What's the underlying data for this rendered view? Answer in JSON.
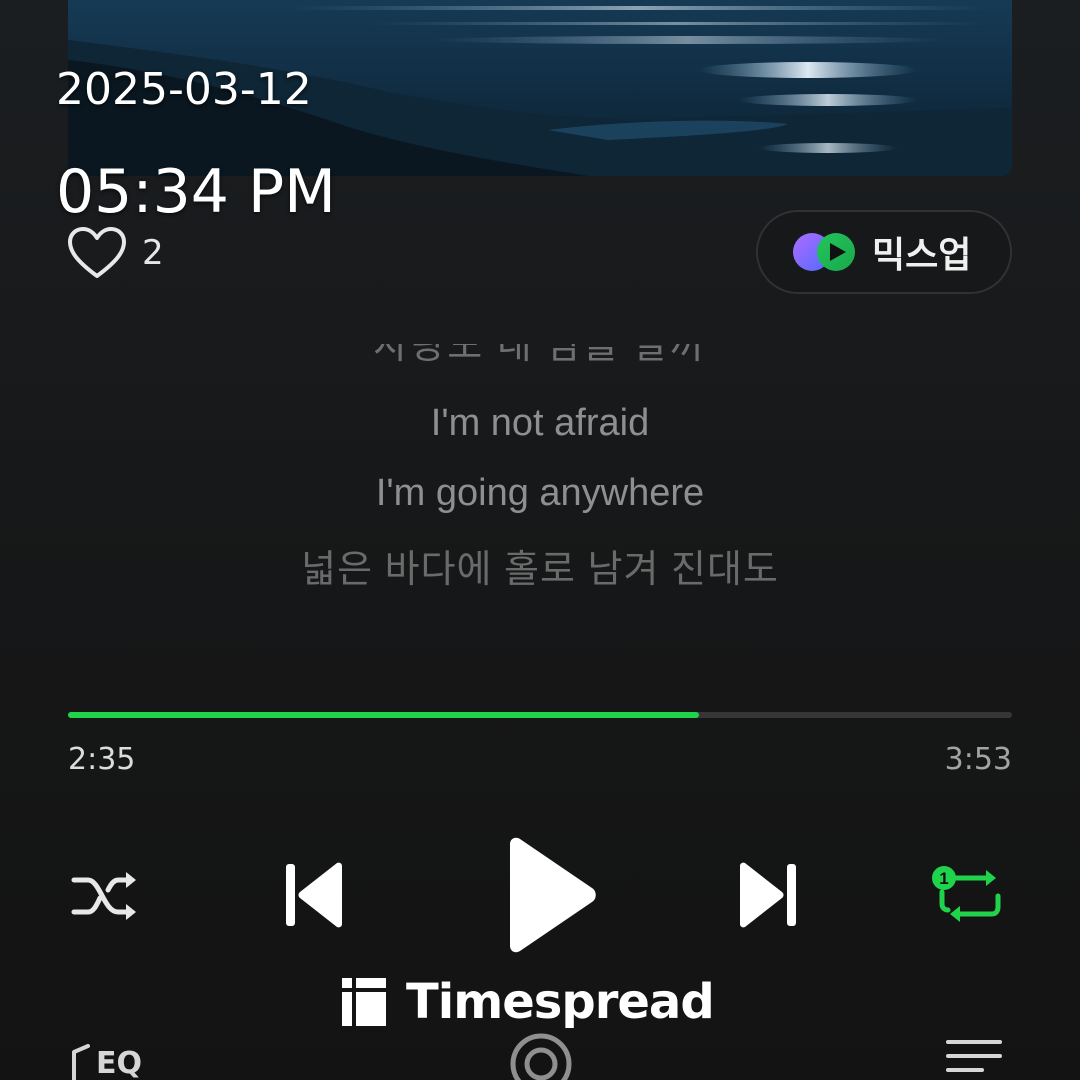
{
  "overlay": {
    "date": "2025-03-12",
    "time": "05:34 PM"
  },
  "track": {
    "like_count": "2",
    "mixup_label": "믹스업"
  },
  "lyrics": {
    "partial_line": "사랑도 내 맘을 알까",
    "lines": [
      "I'm not afraid",
      "I'm going anywhere",
      "넓은 바다에 홀로 남겨 진대도"
    ]
  },
  "progress": {
    "elapsed": "2:35",
    "total": "3:53",
    "fraction": 0.668
  },
  "controls": {
    "repeat_mode_badge": "1"
  },
  "bottom_bar": {
    "eq_label": "EQ"
  },
  "watermark": {
    "text": "Timespread"
  },
  "icons": {
    "shuffle": "shuffle-icon",
    "previous": "skip-previous-icon",
    "play": "play-icon",
    "next": "skip-next-icon",
    "repeat": "repeat-one-icon",
    "like": "heart-icon",
    "mixup": "mixup-logo-icon",
    "eq": "eq-icon",
    "search": "lens-search-icon",
    "playlist": "playlist-icon"
  },
  "colors": {
    "accent": "#1fd44a",
    "background": "#151515",
    "mixup_gradient_start": "#8a5cff",
    "mixup_gradient_end": "#22c55e"
  }
}
